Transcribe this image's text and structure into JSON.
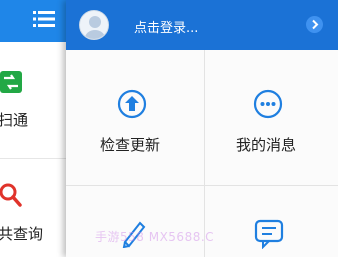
{
  "left_panel": {
    "items": [
      {
        "label": "扫通",
        "icon": "share-icon"
      },
      {
        "label": "共查询",
        "icon": "search-icon"
      }
    ]
  },
  "drawer": {
    "header": {
      "login_text": "点击登录...",
      "avatar_icon": "avatar-icon",
      "arrow_icon": "chevron-right-icon"
    },
    "grid": [
      {
        "label": "检查更新",
        "icon": "upload-arrow-icon"
      },
      {
        "label": "我的消息",
        "icon": "chat-bubble-icon"
      },
      {
        "label": "",
        "icon": "pencil-icon"
      },
      {
        "label": "",
        "icon": "message-icon"
      }
    ]
  },
  "watermark": "手游558 MX5688.C"
}
